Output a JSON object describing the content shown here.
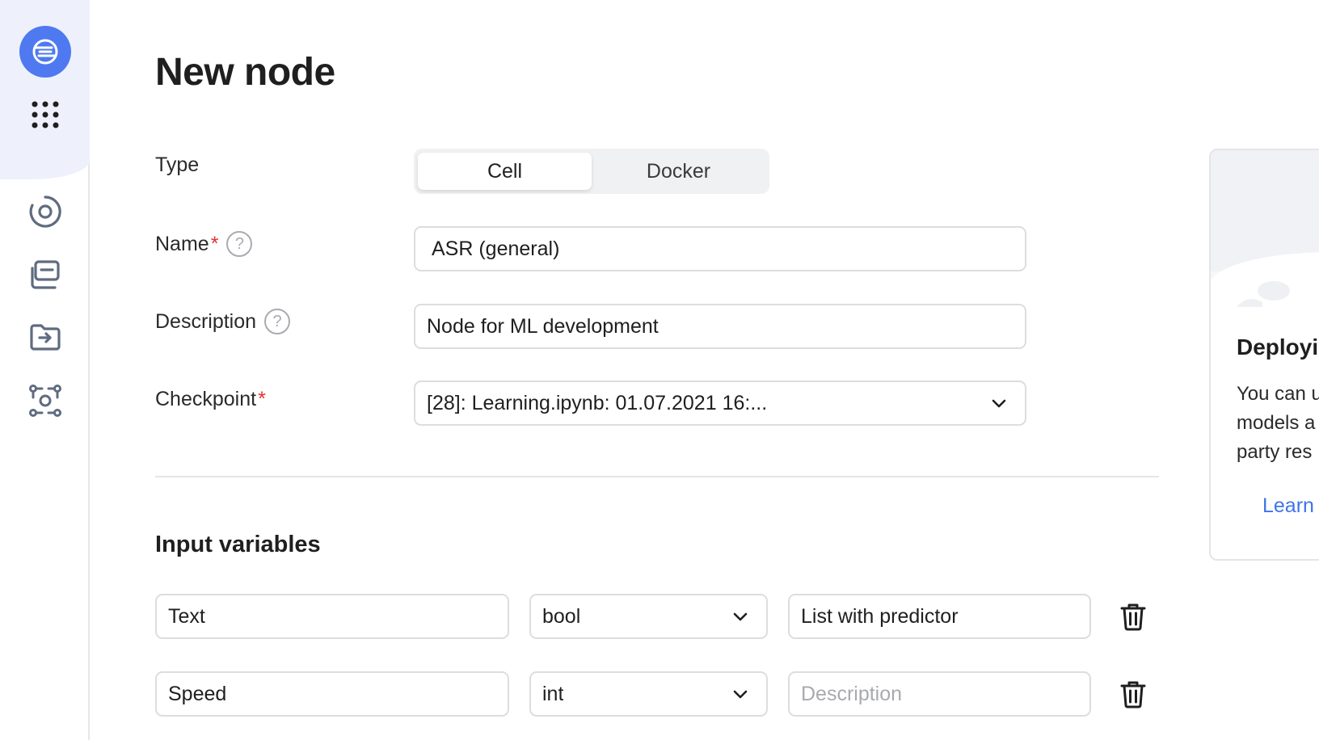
{
  "page": {
    "title": "New node"
  },
  "sidebar": {
    "items": [
      {
        "name": "logo",
        "icon": "datasphere-logo-icon"
      },
      {
        "name": "services",
        "icon": "grid-dots-icon"
      },
      {
        "name": "projects",
        "icon": "target-ring-icon"
      },
      {
        "name": "resources",
        "icon": "stacked-folders-icon"
      },
      {
        "name": "import",
        "icon": "folder-arrow-icon"
      },
      {
        "name": "nodes",
        "icon": "node-graph-icon"
      }
    ]
  },
  "form": {
    "type": {
      "label": "Type",
      "options": [
        "Cell",
        "Docker"
      ],
      "selected": "Cell"
    },
    "name": {
      "label": "Name",
      "required_mark": "*",
      "value": "ASR (general)"
    },
    "description": {
      "label": "Description",
      "value": "Node for ML development"
    },
    "checkpoint": {
      "label": "Checkpoint",
      "required_mark": "*",
      "value": "[28]: Learning.ipynb: 01.07.2021 16:..."
    },
    "help_glyph": "?"
  },
  "input_variables": {
    "title": "Input variables",
    "rows": [
      {
        "name": "Text",
        "type": "bool",
        "description": "List with predictor",
        "description_placeholder": "Description"
      },
      {
        "name": "Speed",
        "type": "int",
        "description": "",
        "description_placeholder": "Description"
      }
    ]
  },
  "info_card": {
    "title": "Deployi",
    "text_lines": [
      "You can u",
      "models a",
      "party res"
    ],
    "link": "Learn"
  },
  "colors": {
    "accent": "#4e79f0",
    "link": "#3f74e8",
    "required": "#e5302f",
    "sidebar_bg": "#eef1fb"
  }
}
